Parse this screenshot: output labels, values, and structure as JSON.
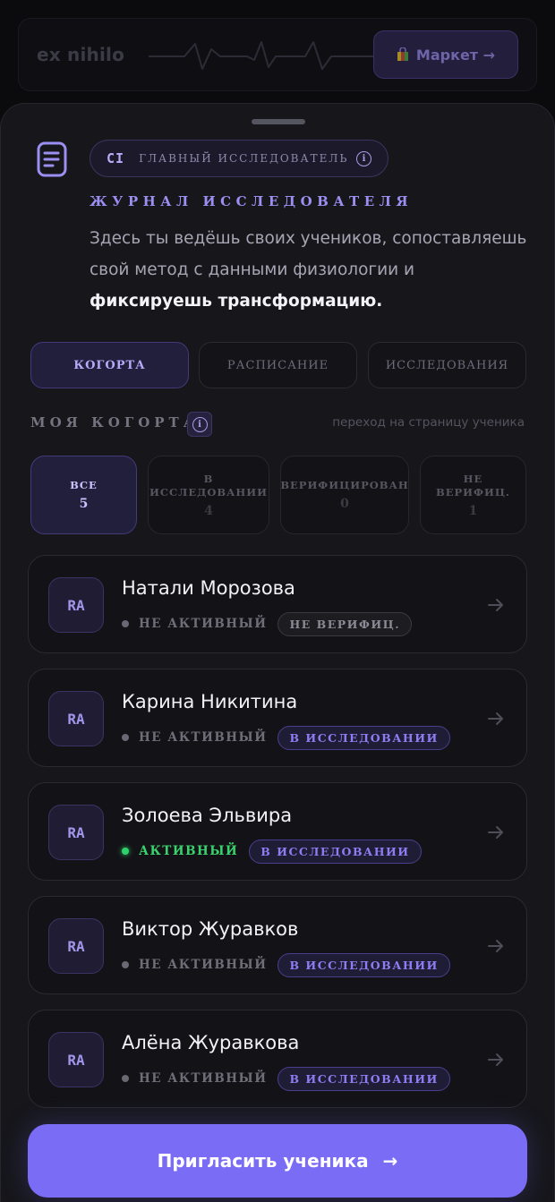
{
  "topbar": {
    "brand": "ex nihilo",
    "market_label": "Маркет →"
  },
  "header": {
    "role_code": "CI",
    "role_label": "ГЛАВНЫЙ ИССЛЕДОВАТЕЛЬ",
    "title": "ЖУРНАЛ ИССЛЕДОВАТЕЛЯ",
    "desc_plain": "Здесь ты ведёшь своих учеников, сопоставляешь свой метод с данными физиологии и ",
    "desc_bold": "фиксируешь трансформацию."
  },
  "tabs": [
    {
      "label": "КОГОРТА",
      "active": true
    },
    {
      "label": "РАСПИСАНИЕ",
      "active": false
    },
    {
      "label": "ИССЛЕДОВАНИЯ",
      "active": false
    }
  ],
  "cohort": {
    "title": "МОЯ КОГОРТА",
    "hint": "переход на страницу ученика"
  },
  "filters": [
    {
      "label": "ВСЕ",
      "count": "5",
      "active": true
    },
    {
      "label": "В ИССЛЕДОВАНИИ",
      "count": "4",
      "active": false
    },
    {
      "label": "ВЕРИФИЦИРОВАН",
      "count": "0",
      "active": false
    },
    {
      "label": "НЕ ВЕРИФИЦ.",
      "count": "1",
      "active": false
    }
  ],
  "students": [
    {
      "initials": "RA",
      "name": "Натали Морозова",
      "status": "НЕ АКТИВНЫЙ",
      "active": false,
      "badge": "НЕ ВЕРИФИЦ.",
      "badge_style": "grey"
    },
    {
      "initials": "RA",
      "name": "Карина Никитина",
      "status": "НЕ АКТИВНЫЙ",
      "active": false,
      "badge": "В ИССЛЕДОВАНИИ",
      "badge_style": "purple"
    },
    {
      "initials": "RA",
      "name": "Золоева Эльвира",
      "status": "АКТИВНЫЙ",
      "active": true,
      "badge": "В ИССЛЕДОВАНИИ",
      "badge_style": "purple"
    },
    {
      "initials": "RA",
      "name": "Виктор Журавков",
      "status": "НЕ АКТИВНЫЙ",
      "active": false,
      "badge": "В ИССЛЕДОВАНИИ",
      "badge_style": "purple"
    },
    {
      "initials": "RA",
      "name": "Алёна Журавкова",
      "status": "НЕ АКТИВНЫЙ",
      "active": false,
      "badge": "В ИССЛЕДОВАНИИ",
      "badge_style": "purple"
    }
  ],
  "cta": {
    "label": "Пригласить ученика",
    "arrow": "→"
  },
  "colors": {
    "accent": "#7b6cf6",
    "active_green": "#2fd16b",
    "sheet_bg": "#16161b"
  }
}
